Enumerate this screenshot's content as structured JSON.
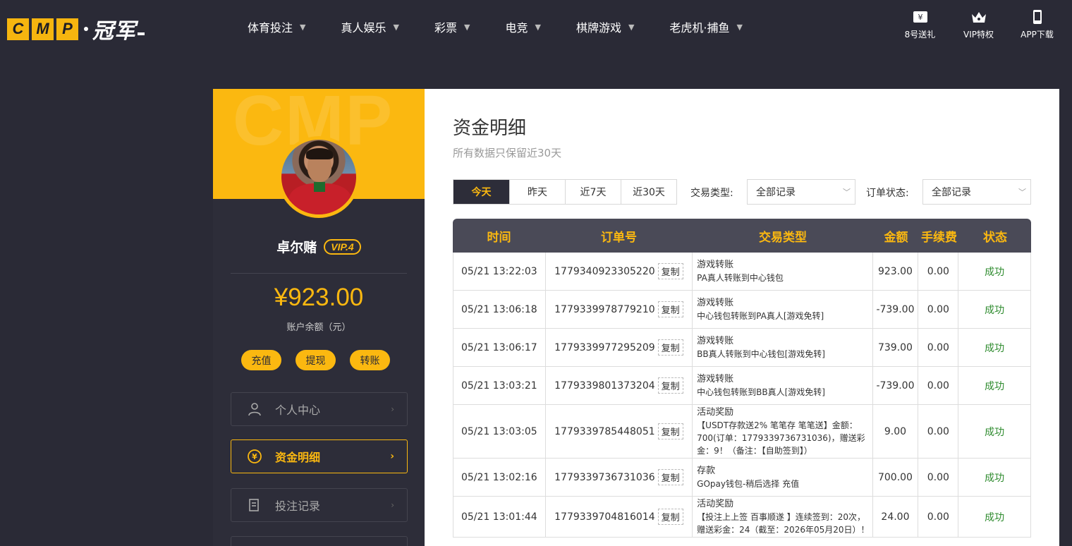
{
  "header": {
    "logo_text": "CMP",
    "logo_cn": "冠军",
    "nav": [
      {
        "label": "体育投注"
      },
      {
        "label": "真人娱乐"
      },
      {
        "label": "彩票"
      },
      {
        "label": "电竞"
      },
      {
        "label": "棋牌游戏"
      },
      {
        "label": "老虎机·捕鱼"
      }
    ],
    "tools": [
      {
        "label": "8号送礼",
        "icon": "ticket-icon"
      },
      {
        "label": "VIP特权",
        "icon": "crown-icon"
      },
      {
        "label": "APP下载",
        "icon": "phone-icon"
      }
    ]
  },
  "sidebar": {
    "banner_text": "CMP",
    "username": "卓尔赌",
    "vip": "VIP.4",
    "balance": "¥923.00",
    "balance_label": "账户余额（元）",
    "actions": [
      "充值",
      "提现",
      "转账"
    ],
    "menu": [
      {
        "label": "个人中心",
        "icon": "user-icon",
        "active": false
      },
      {
        "label": "资金明细",
        "icon": "yen-coin-icon",
        "active": true
      },
      {
        "label": "投注记录",
        "icon": "document-icon",
        "active": false
      }
    ]
  },
  "main": {
    "title": "资金明细",
    "subtitle": "所有数据只保留近30天",
    "tabs": [
      "今天",
      "昨天",
      "近7天",
      "近30天"
    ],
    "active_tab": "今天",
    "filters": {
      "type_label": "交易类型:",
      "type_value": "全部记录",
      "status_label": "订单状态:",
      "status_value": "全部记录"
    },
    "table": {
      "columns": [
        "时间",
        "订单号",
        "交易类型",
        "金额",
        "手续费",
        "状态"
      ],
      "copy_label": "复制",
      "rows": [
        {
          "time": "05/21 13:22:03",
          "order": "1779340923305220",
          "type": "游戏转账",
          "desc": "PA真人转账到中心钱包",
          "amount": "923.00",
          "fee": "0.00",
          "status": "成功"
        },
        {
          "time": "05/21 13:06:18",
          "order": "1779339978779210",
          "type": "游戏转账",
          "desc": "中心钱包转账到PA真人[游戏免转]",
          "amount": "-739.00",
          "fee": "0.00",
          "status": "成功"
        },
        {
          "time": "05/21 13:06:17",
          "order": "1779339977295209",
          "type": "游戏转账",
          "desc": "BB真人转账到中心钱包[游戏免转]",
          "amount": "739.00",
          "fee": "0.00",
          "status": "成功"
        },
        {
          "time": "05/21 13:03:21",
          "order": "1779339801373204",
          "type": "游戏转账",
          "desc": "中心钱包转账到BB真人[游戏免转]",
          "amount": "-739.00",
          "fee": "0.00",
          "status": "成功"
        },
        {
          "time": "05/21 13:03:05",
          "order": "1779339785448051",
          "type": "活动奖励",
          "desc": "【USDT存款送2% 笔笔存 笔笔送】金额：700(订单：1779339736731036)，赠送彩金：9！（备注：【自助签到】）",
          "amount": "9.00",
          "fee": "0.00",
          "status": "成功"
        },
        {
          "time": "05/21 13:02:16",
          "order": "1779339736731036",
          "type": "存款",
          "desc": "GOpay钱包-稍后选择 充值",
          "amount": "700.00",
          "fee": "0.00",
          "status": "成功"
        },
        {
          "time": "05/21 13:01:44",
          "order": "1779339704816014",
          "type": "活动奖励",
          "desc": "【投注上上签 百事顺遂 】连续签到：20次，赠送彩金：24（截至：2026年05月20日）！",
          "amount": "24.00",
          "fee": "0.00",
          "status": "成功"
        }
      ]
    }
  },
  "colors": {
    "accent": "#fbb810",
    "dark": "#2a2a36",
    "success": "#2e8b2e"
  }
}
